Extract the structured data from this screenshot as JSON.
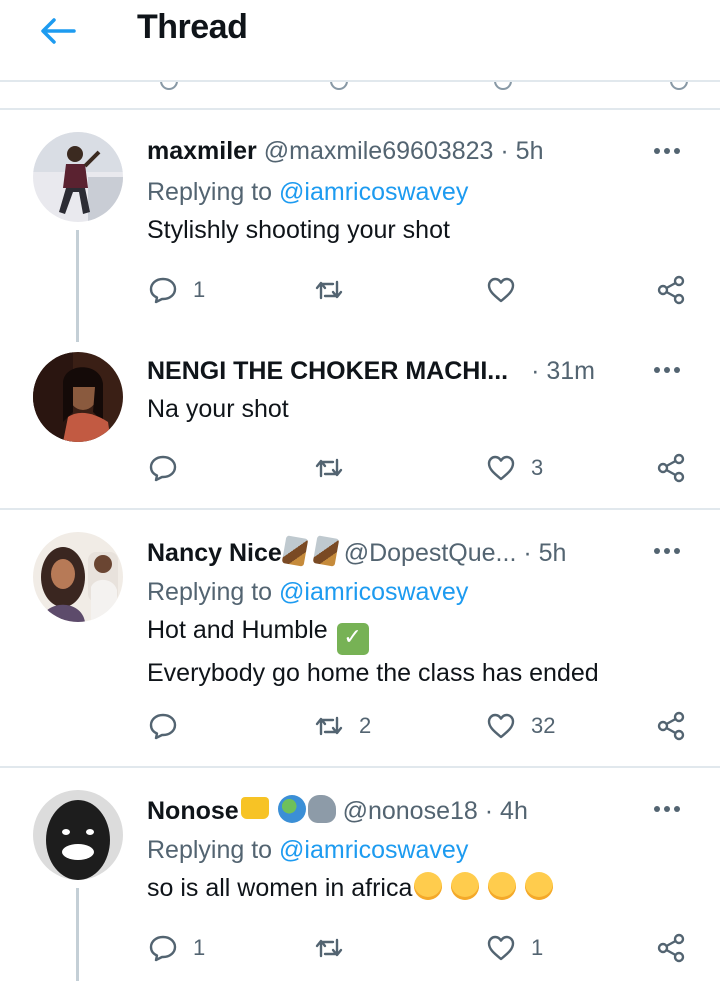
{
  "header": {
    "title": "Thread"
  },
  "tweets": [
    {
      "name": "maxmiler",
      "handle": "@maxmile69603823",
      "time": "· 5h",
      "replying_prefix": "Replying to ",
      "replying_to": "@iamricoswavey",
      "lines": [
        "Stylishly shooting your shot"
      ],
      "reply_count": "1",
      "retweet_count": "",
      "like_count": ""
    },
    {
      "name": "NENGI THE CHOKER MACHI...",
      "handle": "",
      "time": "· 31m",
      "lines": [
        "Na your shot"
      ],
      "reply_count": "",
      "retweet_count": "",
      "like_count": "3"
    },
    {
      "name": "Nancy Nice",
      "name_emojis": [
        "dagger",
        "dagger"
      ],
      "handle": "@DopestQue...",
      "time": "· 5h",
      "replying_prefix": "Replying to ",
      "replying_to": "@iamricoswavey",
      "lines": [
        "Hot and Humble",
        "Everybody go home the class has ended"
      ],
      "line_emoji": "check-mark",
      "reply_count": "",
      "retweet_count": "2",
      "like_count": "32"
    },
    {
      "name": "Nonose",
      "name_emojis": [
        "crown",
        "globe",
        "elephant"
      ],
      "handle": "@nonose18",
      "time": "· 4h",
      "replying_prefix": "Replying to ",
      "replying_to": "@iamricoswavey",
      "lines": [
        "so is all women in africa"
      ],
      "line_emojis": [
        "smirk",
        "smirk",
        "smirk",
        "smirk"
      ],
      "reply_count": "1",
      "retweet_count": "",
      "like_count": "1"
    }
  ],
  "icons": {
    "back": "arrow-left-icon",
    "more": "more-dots-icon",
    "reply": "reply-icon",
    "retweet": "retweet-icon",
    "like": "heart-icon",
    "share": "share-icon"
  },
  "colors": {
    "accent": "#1d9bf0",
    "secondary_text": "#536471",
    "divider": "#e1e8ed",
    "thread_line": "#c4cfd6"
  }
}
